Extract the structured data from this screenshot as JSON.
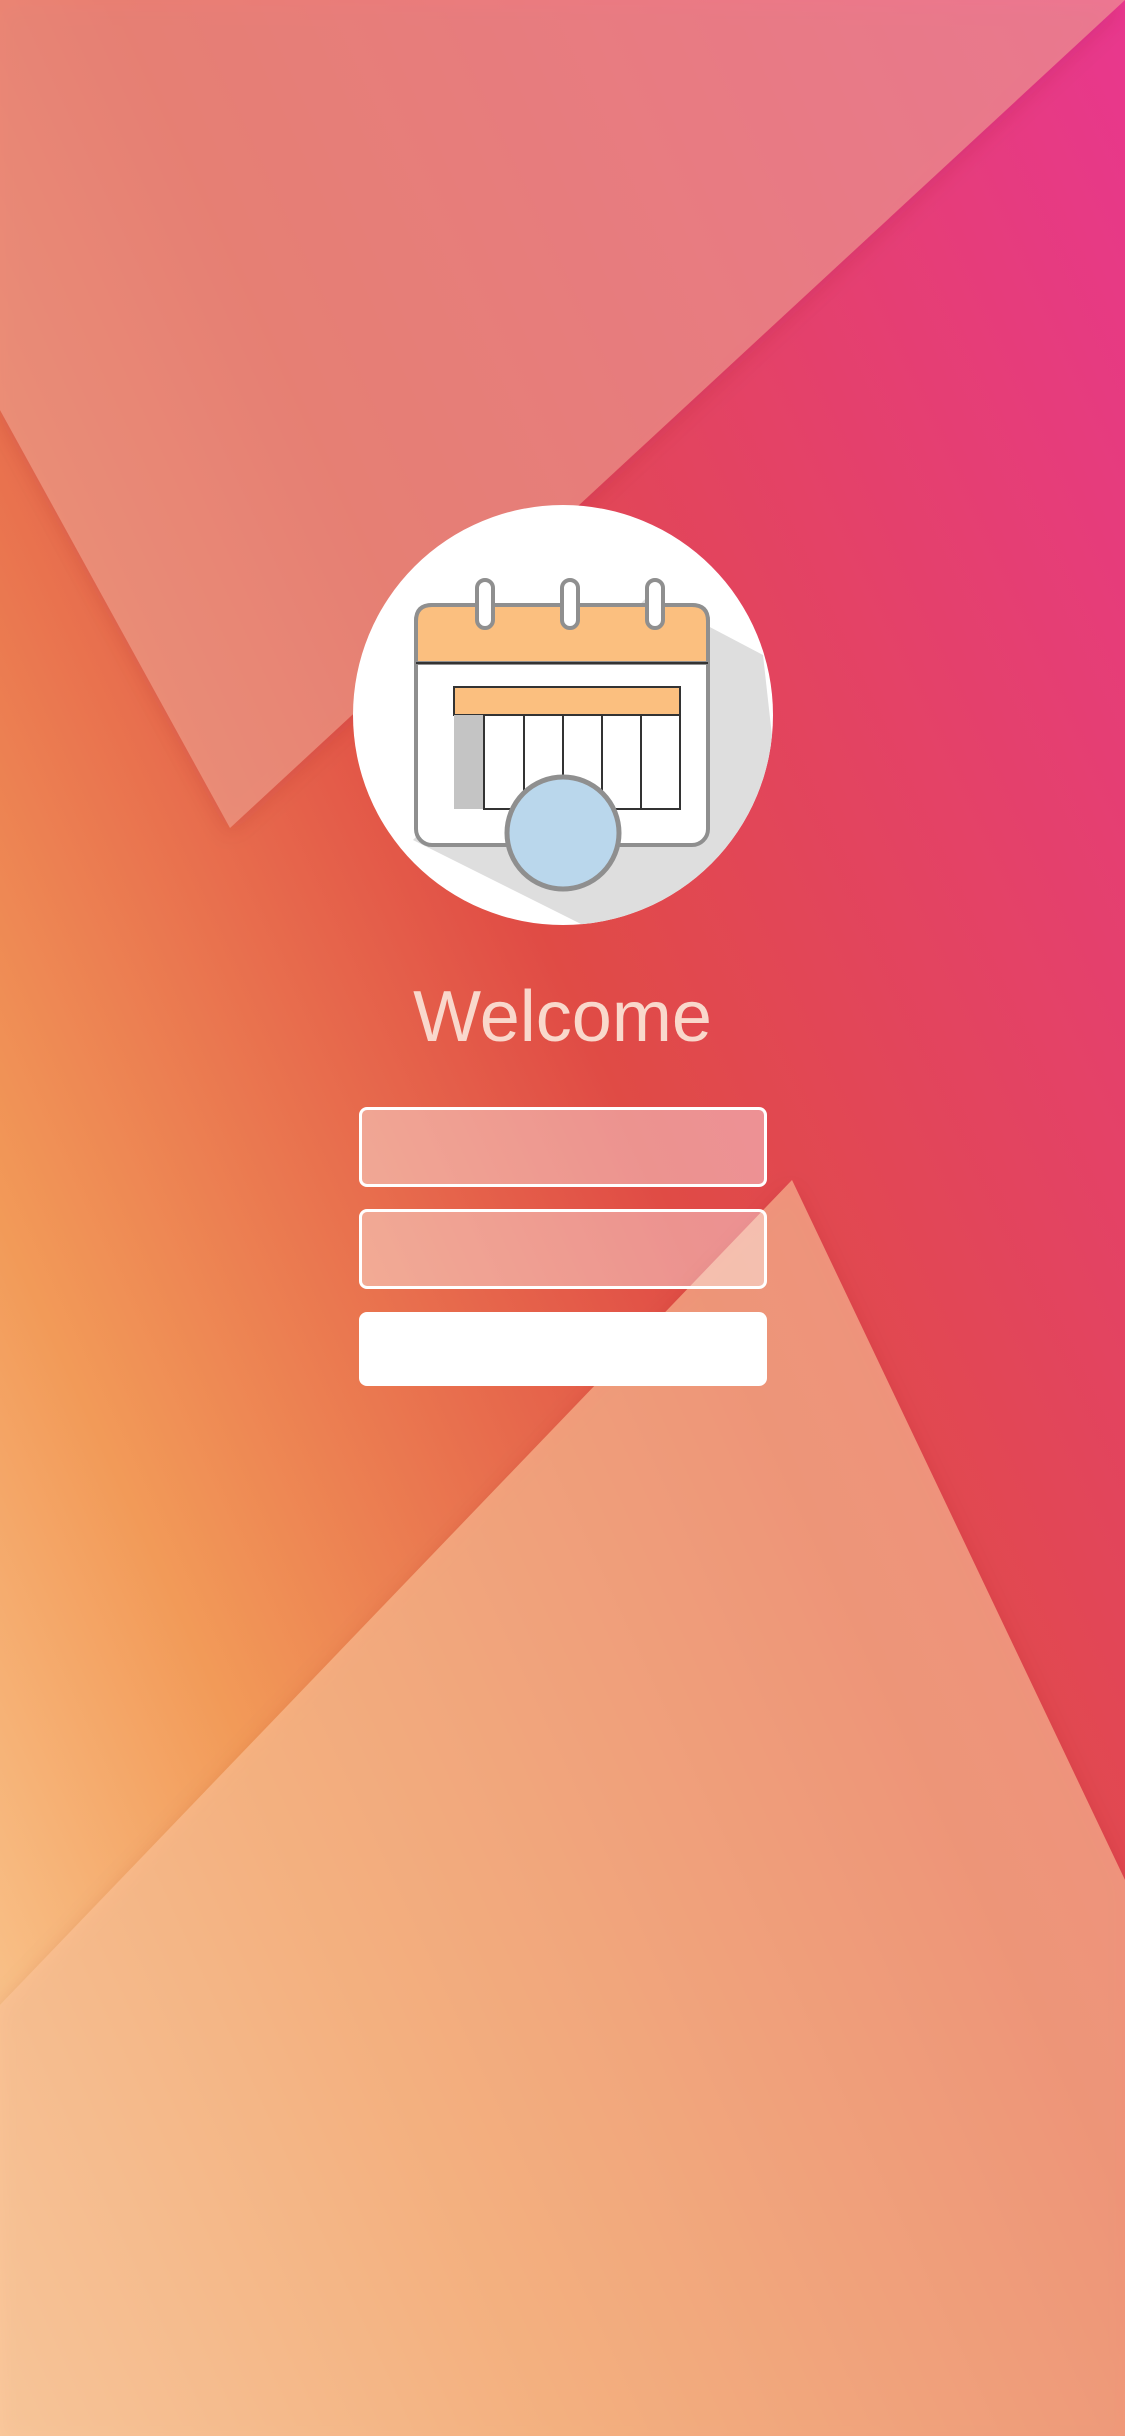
{
  "screen": {
    "title": "Welcome"
  },
  "logo": {
    "icon": "calendar-icon"
  },
  "form": {
    "username_value": "",
    "username_placeholder": "",
    "password_value": "",
    "password_placeholder": "",
    "submit_label": ""
  },
  "colors": {
    "gradient_top_right": "#e83a8c",
    "gradient_mid": "#e04b45",
    "gradient_bottom_left": "#fbd4a0",
    "calendar_header": "#fbbf7f",
    "clock_face": "#bad7ec"
  }
}
